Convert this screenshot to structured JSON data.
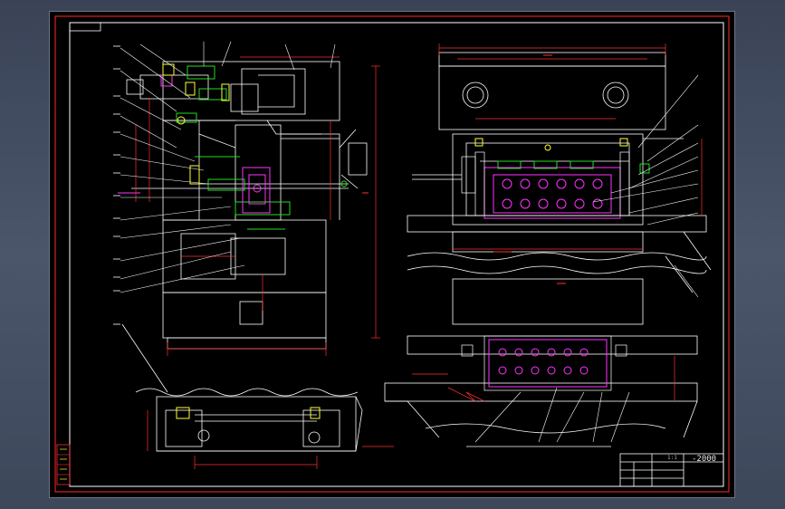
{
  "window": {
    "background": "#3f495c"
  },
  "drawing": {
    "background": "#000000",
    "frame_color": "#ff2a2a",
    "title_block": {
      "scale_code": "1:1",
      "drawing_number": "-2000"
    },
    "colors": {
      "outline": "#ffffff",
      "dimension": "#ff3030",
      "center": "#ffffff",
      "detail": "#ff33ff",
      "green": "#22dd22",
      "yellow": "#ffff33"
    }
  }
}
